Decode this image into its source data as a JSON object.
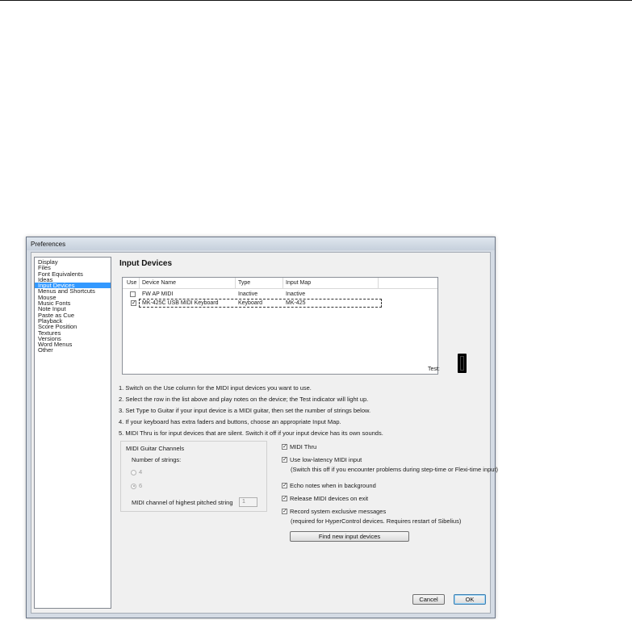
{
  "window": {
    "title": "Preferences"
  },
  "categories": [
    {
      "label": "Display",
      "selected": false
    },
    {
      "label": "Files",
      "selected": false
    },
    {
      "label": "Font Equivalents",
      "selected": false
    },
    {
      "label": "Ideas",
      "selected": false
    },
    {
      "label": "Input Devices",
      "selected": true
    },
    {
      "label": "Menus and Shortcuts",
      "selected": false
    },
    {
      "label": "Mouse",
      "selected": false
    },
    {
      "label": "Music Fonts",
      "selected": false
    },
    {
      "label": "Note Input",
      "selected": false
    },
    {
      "label": "Paste as Cue",
      "selected": false
    },
    {
      "label": "Playback",
      "selected": false
    },
    {
      "label": "Score Position",
      "selected": false
    },
    {
      "label": "Textures",
      "selected": false
    },
    {
      "label": "Versions",
      "selected": false
    },
    {
      "label": "Word Menus",
      "selected": false
    },
    {
      "label": "Other",
      "selected": false
    }
  ],
  "page": {
    "heading": "Input Devices"
  },
  "device_table": {
    "columns": [
      "Use",
      "Device Name",
      "Type",
      "Input Map"
    ],
    "rows": [
      {
        "use": false,
        "device_name": "FW AP MIDI",
        "type": "Inactive",
        "input_map": "Inactive"
      },
      {
        "use": true,
        "device_name": "MK-425C USB MIDI Keyboard",
        "type": "Keyboard",
        "input_map": "MK-425"
      }
    ]
  },
  "test": {
    "label": "Test:"
  },
  "instructions": [
    "1. Switch on the Use column for the MIDI input devices you want to use.",
    "2. Select the row in the list above and play notes on the device; the Test indicator will light up.",
    "3. Set Type to Guitar if your input device is a MIDI guitar, then set the number of strings below.",
    "4. If your keyboard has extra faders and buttons, choose an appropriate Input Map.",
    "5. MIDI Thru is for input devices that are silent. Switch it off if your input device has its own sounds."
  ],
  "midi_guitar": {
    "title": "MIDI Guitar Channels",
    "strings_label": "Number of strings:",
    "options": [
      {
        "label": "4",
        "selected": false
      },
      {
        "label": "6",
        "selected": true
      }
    ],
    "channel_label": "MIDI channel of highest pitched string",
    "channel_value": "1"
  },
  "options": {
    "midi_thru": {
      "label": "MIDI Thru",
      "checked": true
    },
    "low_latency": {
      "label": "Use low-latency MIDI input",
      "checked": true,
      "note": "(Switch this off if you encounter problems during step-time or Flexi-time input)"
    },
    "echo_notes": {
      "label": "Echo notes when in background",
      "checked": true
    },
    "release_midi": {
      "label": "Release MIDI devices on exit",
      "checked": true
    },
    "sysex": {
      "label": "Record system exclusive messages",
      "checked": true,
      "note": "(required for HyperControl devices. Requires restart of Sibelius)"
    }
  },
  "buttons": {
    "find_new": "Find new input devices",
    "cancel": "Cancel",
    "ok": "OK"
  },
  "check_glyph": "✓"
}
